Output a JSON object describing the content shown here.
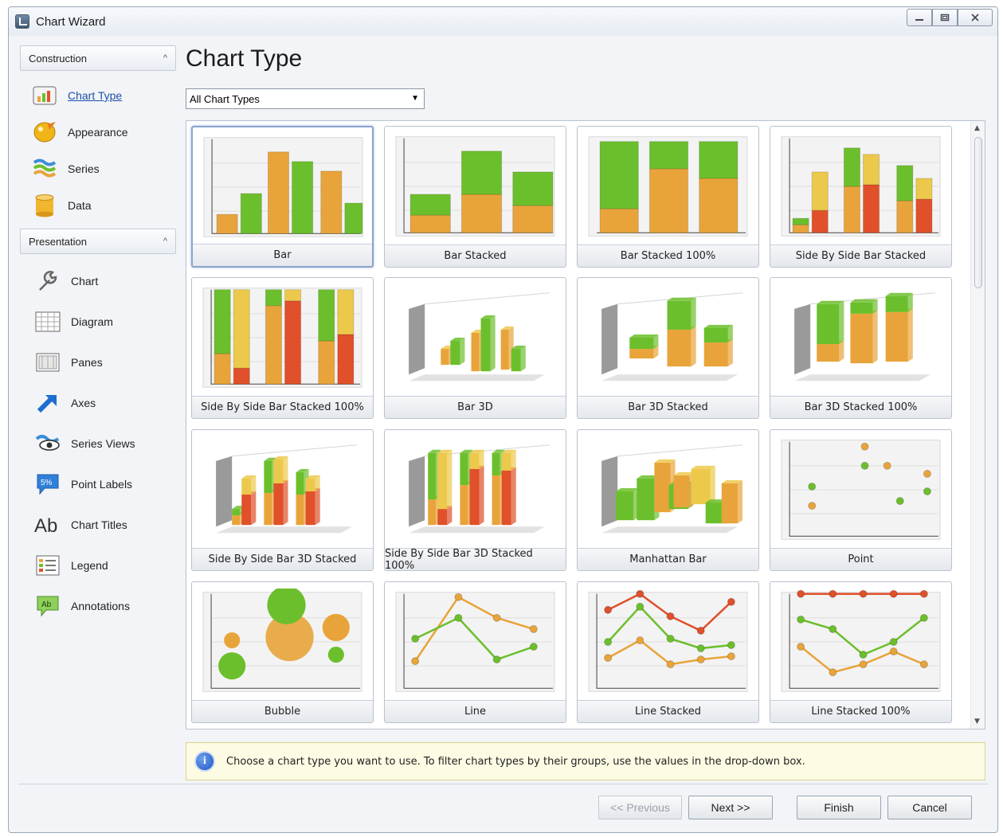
{
  "window": {
    "title": "Chart Wizard"
  },
  "sidebar": {
    "construction": {
      "header": "Construction",
      "items": [
        {
          "label": "Chart Type",
          "icon": "bar-chart-icon",
          "active": true
        },
        {
          "label": "Appearance",
          "icon": "palette-icon"
        },
        {
          "label": "Series",
          "icon": "series-icon"
        },
        {
          "label": "Data",
          "icon": "database-icon"
        }
      ]
    },
    "presentation": {
      "header": "Presentation",
      "items": [
        {
          "label": "Chart",
          "icon": "wrench-icon"
        },
        {
          "label": "Diagram",
          "icon": "diagram-icon"
        },
        {
          "label": "Panes",
          "icon": "panes-icon"
        },
        {
          "label": "Axes",
          "icon": "axes-icon"
        },
        {
          "label": "Series Views",
          "icon": "series-views-icon"
        },
        {
          "label": "Point Labels",
          "icon": "point-labels-icon"
        },
        {
          "label": "Chart Titles",
          "icon": "chart-titles-icon"
        },
        {
          "label": "Legend",
          "icon": "legend-icon"
        },
        {
          "label": "Annotations",
          "icon": "annotations-icon"
        }
      ]
    }
  },
  "main": {
    "title": "Chart Type",
    "filter": {
      "value": "All Chart Types"
    },
    "chart_types": [
      {
        "label": "Bar",
        "kind": "bar",
        "selected": true
      },
      {
        "label": "Bar Stacked",
        "kind": "bar-stacked"
      },
      {
        "label": "Bar Stacked 100%",
        "kind": "bar-stacked-100"
      },
      {
        "label": "Side By Side Bar Stacked",
        "kind": "side-by-side-stacked"
      },
      {
        "label": "Side By Side Bar Stacked 100%",
        "kind": "side-by-side-stacked-100"
      },
      {
        "label": "Bar 3D",
        "kind": "bar-3d"
      },
      {
        "label": "Bar 3D Stacked",
        "kind": "bar-3d-stacked"
      },
      {
        "label": "Bar 3D Stacked 100%",
        "kind": "bar-3d-stacked-100"
      },
      {
        "label": "Side By Side Bar 3D Stacked",
        "kind": "sbs-3d-stacked"
      },
      {
        "label": "Side By Side Bar 3D Stacked 100%",
        "kind": "sbs-3d-stacked-100"
      },
      {
        "label": "Manhattan Bar",
        "kind": "manhattan"
      },
      {
        "label": "Point",
        "kind": "point"
      },
      {
        "label": "Bubble",
        "kind": "bubble"
      },
      {
        "label": "Line",
        "kind": "line"
      },
      {
        "label": "Line Stacked",
        "kind": "line-stacked"
      },
      {
        "label": "Line Stacked 100%",
        "kind": "line-stacked-100"
      }
    ],
    "hint": "Choose a chart type you want to use. To filter chart types by their groups, use the values in the drop-down box."
  },
  "footer": {
    "previous": "<< Previous",
    "next": "Next >>",
    "finish": "Finish",
    "cancel": "Cancel"
  },
  "colors": {
    "green": "#6cbf2c",
    "orange": "#e8a43a",
    "yellow": "#ecc94b",
    "red": "#e0502a",
    "accent_link": "#1d4fa8"
  }
}
